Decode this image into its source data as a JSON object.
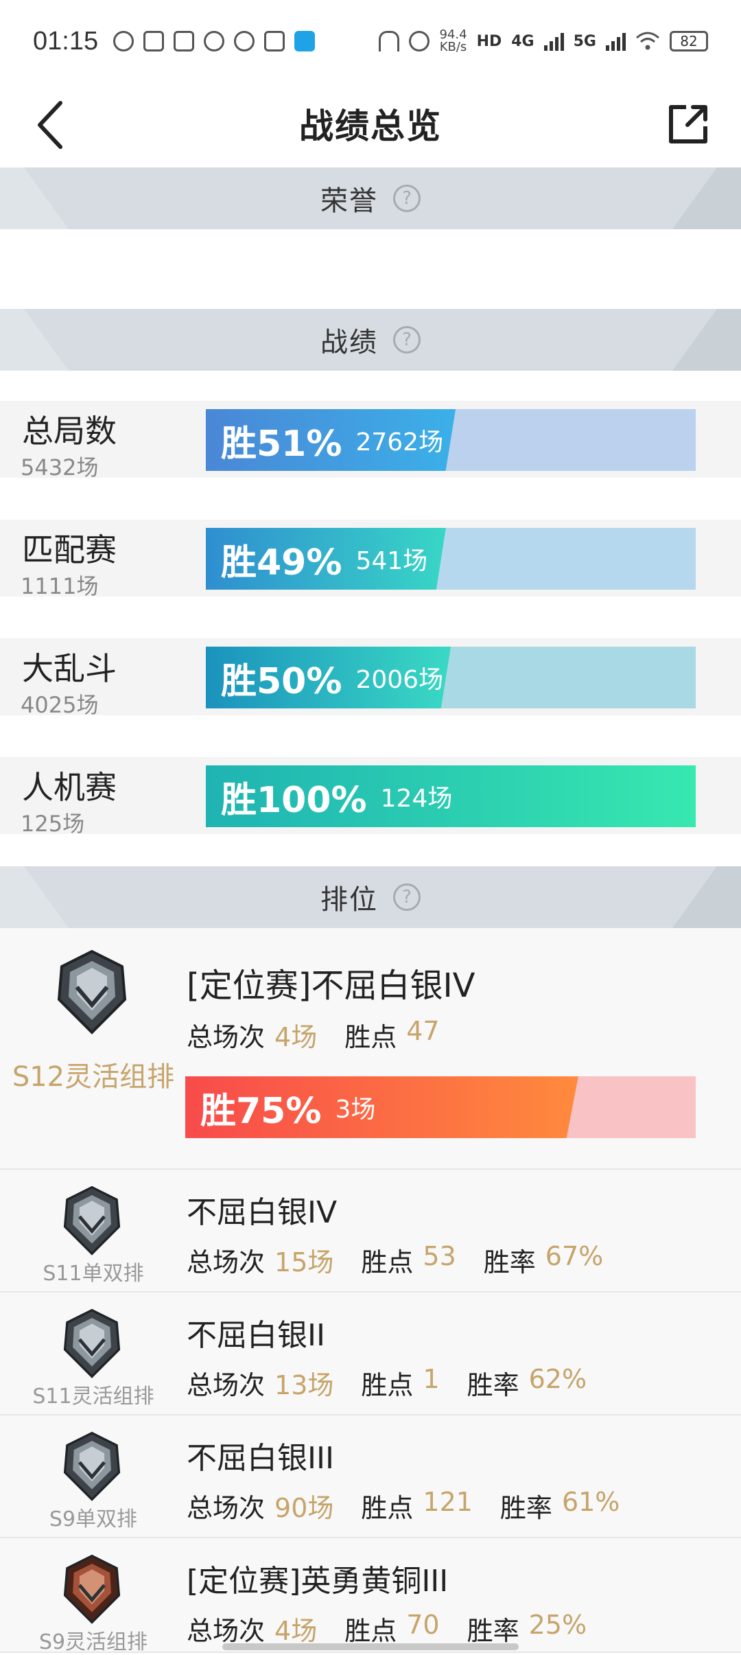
{
  "status_bar": {
    "time": "01:15",
    "net_speed": "94.4",
    "net_unit": "KB/s",
    "hd_tag": "HD",
    "sim1": "4G",
    "sim2": "5G",
    "battery": "82"
  },
  "nav": {
    "title": "战绩总览"
  },
  "sections": {
    "honor": "荣誉",
    "record": "战绩",
    "ranked": "排位",
    "help_glyph": "?"
  },
  "stats": [
    {
      "name": "总局数",
      "total": "5432场",
      "pct": "胜51%",
      "count": "2762场",
      "win_fraction": 0.51
    },
    {
      "name": "匹配赛",
      "total": "1111场",
      "pct": "胜49%",
      "count": "541场",
      "win_fraction": 0.49
    },
    {
      "name": "大乱斗",
      "total": "4025场",
      "pct": "胜50%",
      "count": "2006场",
      "win_fraction": 0.5
    },
    {
      "name": "人机赛",
      "total": "125场",
      "pct": "胜100%",
      "count": "124场",
      "win_fraction": 1.0
    }
  ],
  "ranked_featured": {
    "season": "S12灵活组排",
    "title": "[定位赛]不屈白银IV",
    "games_label": "总场次",
    "games_value": "4场",
    "points_label": "胜点",
    "points_value": "47",
    "pct": "胜75%",
    "count": "3场",
    "win_fraction": 0.75
  },
  "ranked_list": [
    {
      "season": "S11单双排",
      "title": "不屈白银IV",
      "games_label": "总场次",
      "games_value": "15场",
      "points_label": "胜点",
      "points_value": "53",
      "rate_label": "胜率",
      "rate_value": "67%",
      "tier": "silver"
    },
    {
      "season": "S11灵活组排",
      "title": "不屈白银II",
      "games_label": "总场次",
      "games_value": "13场",
      "points_label": "胜点",
      "points_value": "1",
      "rate_label": "胜率",
      "rate_value": "62%",
      "tier": "silver"
    },
    {
      "season": "S9单双排",
      "title": "不屈白银III",
      "games_label": "总场次",
      "games_value": "90场",
      "points_label": "胜点",
      "points_value": "121",
      "rate_label": "胜率",
      "rate_value": "61%",
      "tier": "silver"
    },
    {
      "season": "S9灵活组排",
      "title": "[定位赛]英勇黄铜III",
      "games_label": "总场次",
      "games_value": "4场",
      "points_label": "胜点",
      "points_value": "70",
      "rate_label": "胜率",
      "rate_value": "25%",
      "tier": "bronze"
    }
  ],
  "colors": {
    "accent_gold": "#c6a46a",
    "header_bg": "#d6dce2"
  }
}
